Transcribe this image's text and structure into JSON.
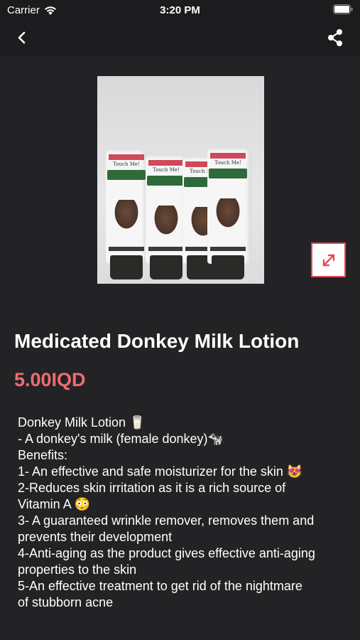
{
  "status_bar": {
    "carrier": "Carrier",
    "time": "3:20 PM"
  },
  "product": {
    "image_alt": "Touch Me Donkey Milk lotion tubes",
    "title": "Medicated Donkey Milk Lotion",
    "price": "5.00IQD",
    "description_lines": [
      "Donkey Milk Lotion 🥛",
      "- A donkey's milk (female donkey)🐄",
      "Benefits:",
      "1- An effective and safe moisturizer for the skin 😻",
      "2-Reduces skin irritation as it is a rich source of",
      "Vitamin A 😳",
      "3- A guaranteed wrinkle remover, removes them and",
      "prevents their development",
      "4-Anti-aging as the product gives effective anti-aging",
      "properties to the skin",
      "5-An effective treatment to get rid of the nightmare",
      "of stubborn acne"
    ]
  },
  "tube_label": {
    "brand": "Touch Me!"
  },
  "colors": {
    "background": "#1c1c1e",
    "content_background": "#232325",
    "price": "#ef6b72",
    "expand_border": "#e14b5a"
  }
}
